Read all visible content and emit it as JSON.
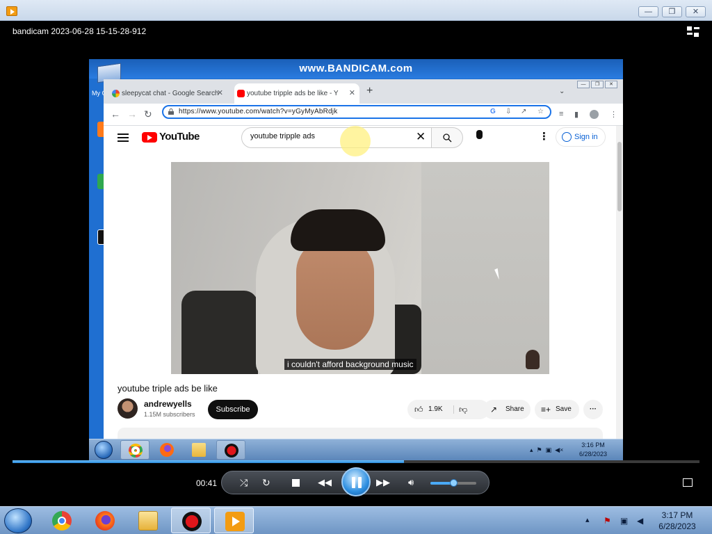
{
  "window": {
    "file_title": "bandicam 2023-06-28 15-15-28-912",
    "minimize": "—",
    "maximize": "❐",
    "close": "✕"
  },
  "recording": {
    "watermark": "www.BANDICAM.com",
    "desktop_label": "My C"
  },
  "browser": {
    "tabs": [
      {
        "title": "sleepycat chat - Google Search",
        "favicon": "google-icon",
        "active": false
      },
      {
        "title": "youtube tripple ads be like - Y",
        "favicon": "youtube-icon",
        "active": true
      }
    ],
    "new_tab": "+",
    "url": "https://www.youtube.com/watch?v=yGyMyAbRdjk"
  },
  "youtube": {
    "logo_text": "YouTube",
    "search_query": "youtube tripple ads",
    "sign_in": "Sign in",
    "subtitle": "i couldn't afford background music",
    "video_title": "youtube triple ads be like",
    "channel_name": "andrewyells",
    "channel_subs": "1.15M subscribers",
    "subscribe": "Subscribe",
    "likes": "1.9K",
    "share": "Share",
    "save": "Save",
    "more": "···"
  },
  "rec_taskbar": {
    "time": "3:16 PM",
    "date": "6/28/2023"
  },
  "player": {
    "elapsed": "00:41",
    "progress_fraction": 0.57,
    "volume_fraction": 0.5,
    "state": "playing"
  },
  "taskbar": {
    "time": "3:17 PM",
    "date": "6/28/2023",
    "apps": [
      "chrome-icon",
      "firefox-icon",
      "file-explorer-icon",
      "bandicam-icon",
      "bandicut-player-icon"
    ]
  },
  "colors": {
    "youtube_red": "#ff0000",
    "omnibox_focus": "#1a73e8",
    "seek_blue": "#2a88d8"
  }
}
